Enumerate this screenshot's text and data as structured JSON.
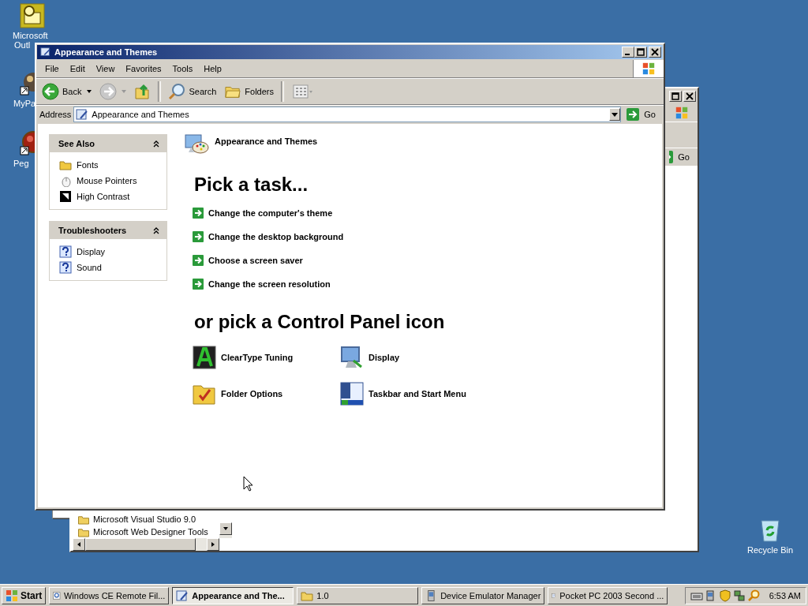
{
  "desktop": {
    "icons": [
      {
        "lines": [
          "Microsoft",
          "Outl"
        ],
        "kind": "outlook"
      },
      {
        "lines": [
          "MyPa"
        ],
        "kind": "shortcut"
      },
      {
        "lines": [
          "Peg"
        ],
        "kind": "ball"
      },
      {
        "lines": [
          "Recycle Bin"
        ],
        "kind": "recycle"
      }
    ]
  },
  "back_window": {
    "go": "Go",
    "list_items": [
      "Microsoft Visual Studio 9.0",
      "Microsoft Web Designer Tools"
    ]
  },
  "window": {
    "title": "Appearance and Themes",
    "menu": [
      "File",
      "Edit",
      "View",
      "Favorites",
      "Tools",
      "Help"
    ],
    "toolbar": [
      {
        "kind": "back",
        "label": "Back"
      },
      {
        "kind": "forward"
      },
      {
        "kind": "up"
      },
      {
        "kind": "search",
        "label": "Search"
      },
      {
        "kind": "folders",
        "label": "Folders"
      },
      {
        "kind": "views"
      }
    ],
    "address": {
      "label": "Address",
      "value": "Appearance and Themes",
      "go": "Go"
    },
    "sidebar": [
      {
        "title": "See Also",
        "expanded": true,
        "items": [
          {
            "label": "Fonts",
            "kind": "fonts"
          },
          {
            "label": "Mouse Pointers",
            "kind": "mouse"
          },
          {
            "label": "High Contrast",
            "kind": "contrast"
          }
        ]
      },
      {
        "title": "Troubleshooters",
        "expanded": true,
        "items": [
          {
            "label": "Display",
            "kind": "help"
          },
          {
            "label": "Sound",
            "kind": "help"
          }
        ]
      }
    ],
    "heading": "Appearance and Themes",
    "tasks_title": "Pick a task...",
    "tasks": [
      "Change the computer's theme",
      "Change the desktop background",
      "Choose a screen saver",
      "Change the screen resolution"
    ],
    "icons_title": "or pick a Control Panel icon",
    "icons": [
      {
        "label": "ClearType Tuning",
        "kind": "cleartype"
      },
      {
        "label": "Display",
        "kind": "display"
      },
      {
        "label": "Folder Options",
        "kind": "folder"
      },
      {
        "label": "Taskbar and Start Menu",
        "kind": "taskbar"
      }
    ]
  },
  "taskbar": {
    "start": "Start",
    "tasks": [
      {
        "label": "Windows CE Remote Fil...",
        "kind": "search",
        "selected": false
      },
      {
        "label": "Appearance and The...",
        "kind": "explorer",
        "selected": true
      },
      {
        "label": "1.0",
        "kind": "folder",
        "selected": false
      },
      {
        "label": "Device Emulator Manager",
        "kind": "device",
        "selected": false
      },
      {
        "label": "Pocket PC 2003 Second ...",
        "kind": "document",
        "selected": false
      }
    ],
    "clock": "6:53 AM"
  }
}
